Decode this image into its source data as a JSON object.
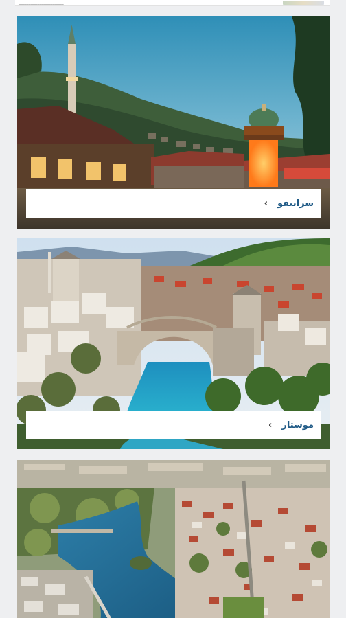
{
  "top_strip": {
    "text": "________________________"
  },
  "cards": [
    {
      "city": "سراييفو",
      "chevron": "‹"
    },
    {
      "city": "موستار",
      "chevron": "‹"
    }
  ]
}
